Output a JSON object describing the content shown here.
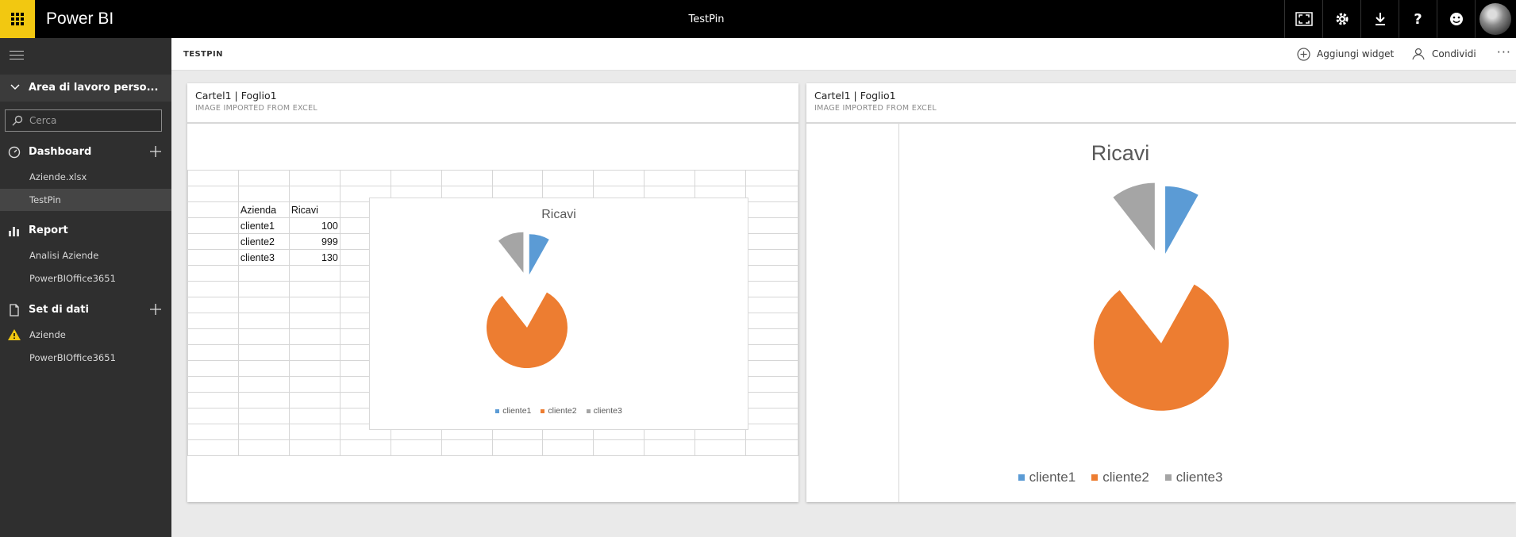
{
  "topbar": {
    "brand": "Power BI",
    "title": "TestPin"
  },
  "sidebar": {
    "workspace": "Area di lavoro perso...",
    "search_placeholder": "Cerca",
    "dashboard": {
      "label": "Dashboard",
      "items": [
        "Aziende.xlsx",
        "TestPin"
      ]
    },
    "report": {
      "label": "Report",
      "items": [
        "Analisi Aziende",
        "PowerBIOffice3651"
      ]
    },
    "datasets": {
      "label": "Set di dati",
      "items": [
        "Aziende",
        "PowerBIOffice3651"
      ]
    }
  },
  "header": {
    "page_label": "TESTPIN",
    "add_widget": "Aggiungi widget",
    "share": "Condividi",
    "more": "···"
  },
  "tiles": [
    {
      "title": "Cartel1 | Foglio1",
      "subtitle": "IMAGE IMPORTED FROM EXCEL"
    },
    {
      "title": "Cartel1 | Foglio1",
      "subtitle": "IMAGE IMPORTED FROM EXCEL"
    }
  ],
  "sheet": {
    "headers": [
      "Azienda",
      "Ricavi"
    ],
    "rows": [
      [
        "cliente1",
        "100"
      ],
      [
        "cliente2",
        "999"
      ],
      [
        "cliente3",
        "130"
      ]
    ]
  },
  "colors": {
    "cliente1": "#5b9bd5",
    "cliente2": "#ed7d31",
    "cliente3": "#a5a5a5",
    "accent": "#f2c811"
  },
  "chart_data": {
    "type": "pie",
    "title": "Ricavi",
    "categories": [
      "cliente1",
      "cliente2",
      "cliente3"
    ],
    "values": [
      100,
      999,
      130
    ],
    "legend": "bottom",
    "exploded": true
  }
}
